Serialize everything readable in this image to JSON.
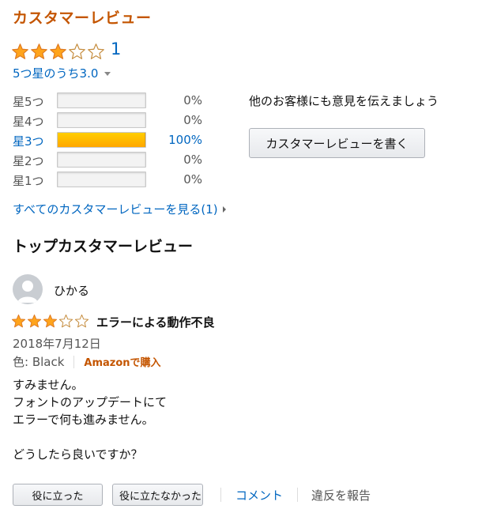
{
  "section": {
    "title": "カスタマーレビュー"
  },
  "summary": {
    "rating": 3,
    "max_rating": 5,
    "review_count": "1",
    "rating_text": "5つ星のうち3.0"
  },
  "histogram": [
    {
      "label": "星5つ",
      "percent_text": "0%",
      "fraction": 0
    },
    {
      "label": "星4つ",
      "percent_text": "0%",
      "fraction": 0
    },
    {
      "label": "星3つ",
      "percent_text": "100%",
      "fraction": 1
    },
    {
      "label": "星2つ",
      "percent_text": "0%",
      "fraction": 0
    },
    {
      "label": "星1つ",
      "percent_text": "0%",
      "fraction": 0
    }
  ],
  "share": {
    "prompt": "他のお客様にも意見を伝えましょう",
    "button_label": "カスタマーレビューを書く"
  },
  "all_reviews_link": "すべてのカスタマーレビューを見る(1)",
  "top_reviews_title": "トップカスタマーレビュー",
  "review": {
    "reviewer": "ひかる",
    "rating": 3,
    "title": "エラーによる動作不良",
    "date": "2018年7月12日",
    "color": "色: Black",
    "verified": "Amazonで購入",
    "body": [
      "すみません。",
      "フォントのアップデートにて",
      "エラーで何も進みません。",
      "",
      "どうしたら良いですか？"
    ]
  },
  "actions": {
    "helpful": "役に立った",
    "not_helpful": "役に立たなかった",
    "comment": "コメント",
    "report": "違反を報告"
  },
  "colors": {
    "brand_orange": "#c45500",
    "link_blue": "#0066c0",
    "star_fill": "#ffa41c",
    "star_outline": "#de7921"
  }
}
